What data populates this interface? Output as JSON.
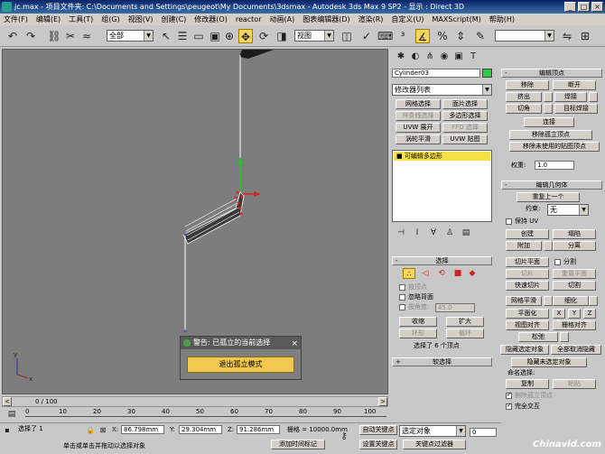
{
  "window": {
    "title": "jc.max - 项目文件夹: C:\\Documents and Settings\\peugeot\\My Documents\\3dsmax - Autodesk 3ds Max 9 SP2 - 显示 : Direct 3D",
    "buttons": [
      "_",
      "□",
      "×"
    ]
  },
  "menu": [
    "文件(F)",
    "编辑(E)",
    "工具(T)",
    "组(G)",
    "视图(V)",
    "创建(C)",
    "修改器(O)",
    "reactor",
    "动画(A)",
    "图表编辑器(D)",
    "渲染(R)",
    "自定义(U)",
    "MAXScript(M)",
    "帮助(H)"
  ],
  "toolbar": {
    "selection_filter": "全部",
    "ref_coord": "视图",
    "named_sel": ""
  },
  "viewport": {
    "label": "",
    "axis_x": "x",
    "axis_y": "y"
  },
  "dialog": {
    "title": "警告: 已孤立的当前选择",
    "close": "×",
    "button": "退出孤立模式"
  },
  "panel": {
    "object_name": "Cylinder03",
    "color": "#2ecc40",
    "modifier_list": "修改器列表",
    "mod_buttons": [
      "网格选择",
      "面片选择",
      "样条线选择",
      "多边形选择",
      "UVW 展开",
      "FFD 选择",
      "涡轮平滑",
      "UVW 贴图"
    ],
    "stack_item": "可编辑多边形",
    "select_header": "选择",
    "by_vertex": "按顶点",
    "ignore_backface": "忽略背面",
    "by_angle": "按角度:",
    "angle_value": "45.0",
    "shrink": "收缩",
    "grow": "扩大",
    "ring": "环形",
    "loop": "循环",
    "selected_info": "选择了 6 个顶点",
    "soft_sel": "软选择"
  },
  "rpanel": {
    "edit_vertices": "编辑顶点",
    "remove": "移除",
    "break": "断开",
    "extrude": "挤出",
    "weld": "焊接",
    "chamfer": "切角",
    "target_weld": "目标焊接",
    "connect": "连接",
    "remove_isolated": "移除孤立顶点",
    "remove_unused": "移除未使用的贴图顶点",
    "weight_label": "权重:",
    "weight_value": "1.0",
    "edit_geometry": "编辑几何体",
    "repeat_last": "重复上一个",
    "constraints": "约束:",
    "constraints_value": "无",
    "preserve_uv": "保持 UV",
    "create": "创建",
    "collapse": "塌陷",
    "attach": "附加",
    "detach": "分离",
    "slice_plane": "切片平面",
    "split": "分割",
    "slice": "切片",
    "reset_plane": "重置平面",
    "quickslice": "快速切片",
    "cut": "切割",
    "meshsmooth": "网格平滑",
    "tessellate": "细化",
    "make_planar": "平面化",
    "x": "X",
    "y": "Y",
    "z": "Z",
    "view_align": "视图对齐",
    "grid_align": "栅格对齐",
    "relax": "松弛",
    "hide_selected": "隐藏选定对象",
    "unhide_all": "全部取消隐藏",
    "hide_unselected": "隐藏未选定对象",
    "named_sel": "命名选择:",
    "copy": "复制",
    "paste": "粘贴",
    "delete_isolated": "删除孤立顶点",
    "full_interactivity": "完全交互"
  },
  "timeline": {
    "frame": "0 / 100",
    "ticks": [
      "0",
      "10",
      "20",
      "30",
      "40",
      "50",
      "60",
      "70",
      "80",
      "90",
      "100"
    ]
  },
  "status": {
    "selected": "选择了 1",
    "x_label": "X:",
    "x_value": "86.798mm",
    "y_label": "Y:",
    "y_value": "29.304mm",
    "z_label": "Z:",
    "z_value": "91.286mm",
    "grid": "栅格 = 10000.0mm",
    "auto_key": "自动关键点",
    "set_key": "设置关键点",
    "sel_obj": "选定对象",
    "key_filters": "关键点过滤器",
    "prompt": "单击或单击并拖动以选择对象",
    "add_tag": "添加时间标记",
    "frame_field": "0",
    "watermark": "Chinavid.com"
  }
}
